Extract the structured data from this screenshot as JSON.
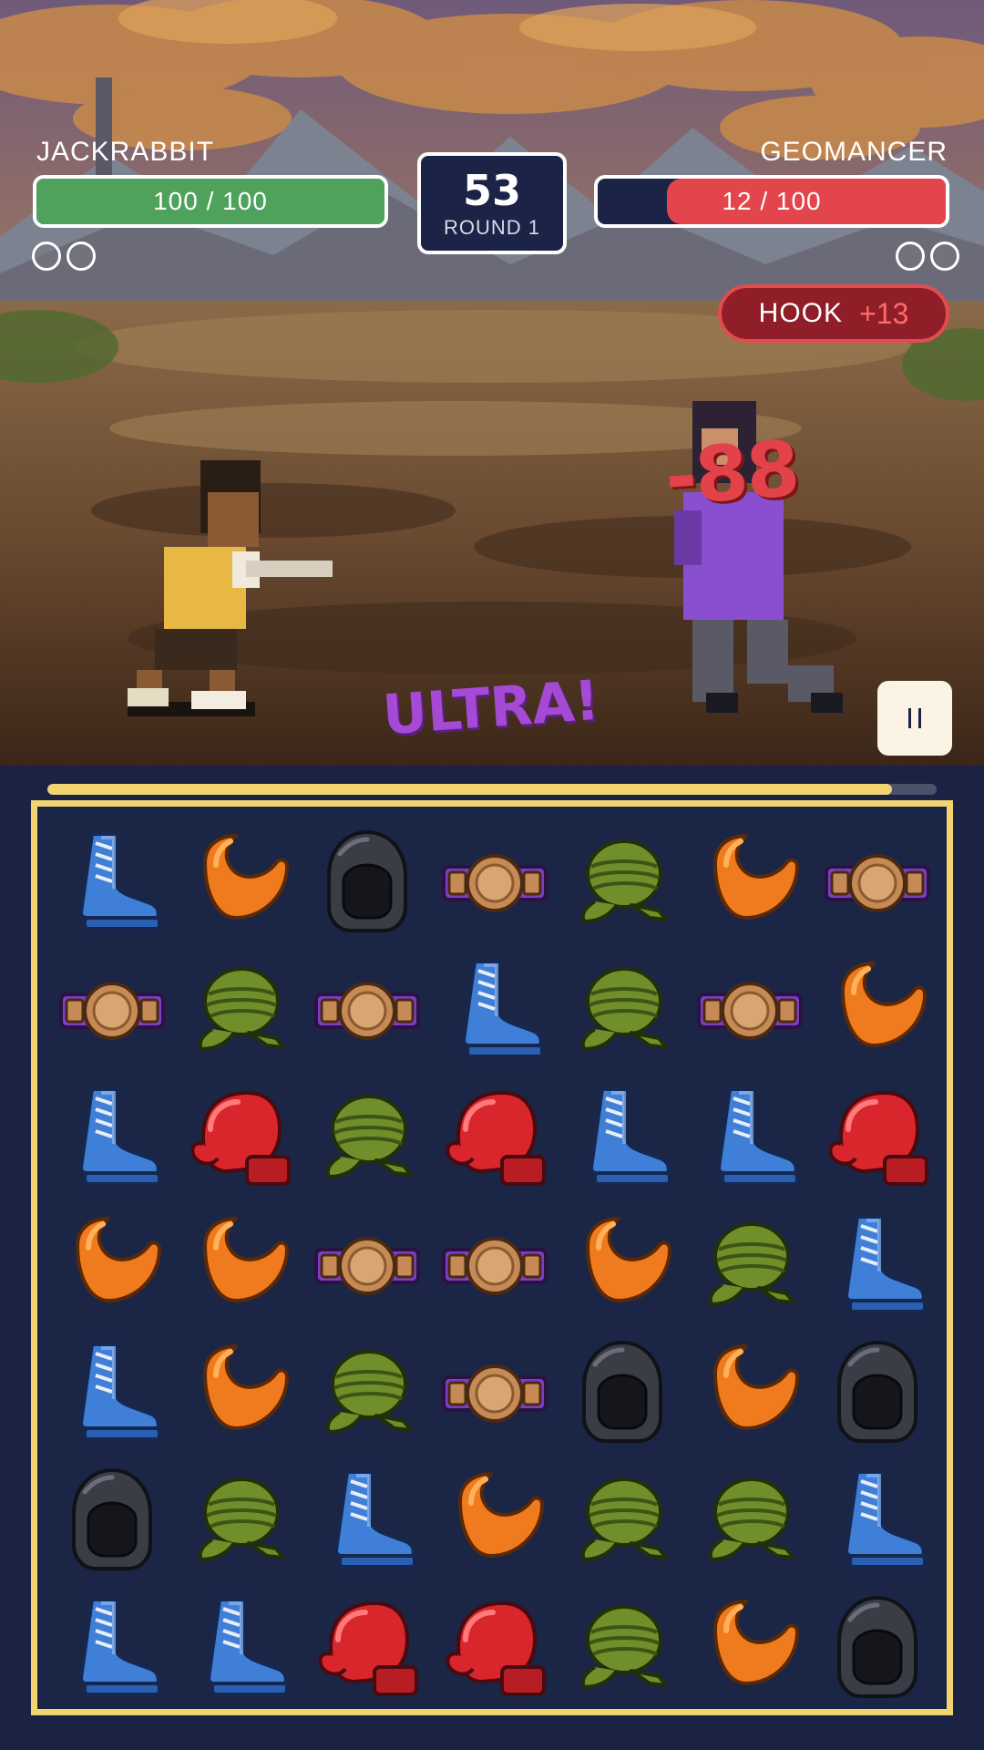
{
  "player": {
    "name": "JACKRABBIT",
    "hp_text": "100 / 100",
    "hp": 100,
    "hp_max": 100,
    "rounds_won": 0
  },
  "opponent": {
    "name": "GEOMANCER",
    "hp_text": "12 / 100",
    "hp": 12,
    "hp_max": 100,
    "rounds_won": 0
  },
  "timer": {
    "value": "53",
    "round": "ROUND 1"
  },
  "move": {
    "name": "HOOK",
    "bonus": "+13"
  },
  "damage_popup": "-88",
  "combo": "ULTRA!",
  "match_progress": 0.95,
  "board": {
    "columns": 7,
    "rows": 7,
    "tiles": [
      [
        "boot",
        "mouthguard",
        "helmet",
        "belt",
        "wraps",
        "mouthguard",
        "belt"
      ],
      [
        "belt",
        "wraps",
        "belt",
        "boot",
        "wraps",
        "belt",
        "mouthguard"
      ],
      [
        "boot",
        "glove",
        "wraps",
        "glove",
        "boot",
        "boot",
        "glove"
      ],
      [
        "mouthguard",
        "mouthguard",
        "belt",
        "belt",
        "mouthguard",
        "wraps",
        "boot"
      ],
      [
        "boot",
        "mouthguard",
        "wraps",
        "belt",
        "helmet",
        "mouthguard",
        "helmet"
      ],
      [
        "helmet",
        "wraps",
        "boot",
        "mouthguard",
        "wraps",
        "wraps",
        "boot"
      ],
      [
        "boot",
        "boot",
        "glove",
        "glove",
        "wraps",
        "mouthguard",
        "helmet"
      ]
    ]
  },
  "tile_icons": {
    "boot": "boxing-boot-icon",
    "mouthguard": "mouthguard-icon",
    "helmet": "headgear-icon",
    "belt": "championship-belt-icon",
    "wraps": "hand-wraps-icon",
    "glove": "boxing-glove-icon"
  },
  "colors": {
    "player_hp": "#4fa25c",
    "opponent_hp": "#e2464c",
    "board_border": "#f2d570",
    "board_bg": "#1b2546",
    "combo": "#a54ad4",
    "damage": "#e3424a"
  }
}
